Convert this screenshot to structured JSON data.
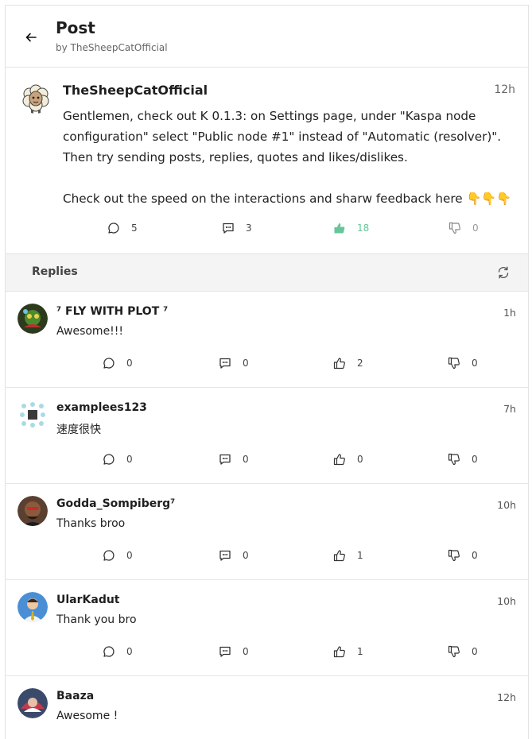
{
  "header": {
    "title": "Post",
    "subtitle": "by TheSheepCatOfficial"
  },
  "post": {
    "author": "TheSheepCatOfficial",
    "time": "12h",
    "body": "Gentlemen, check out K 0.1.3: on Settings page, under \"Kaspa node configuration\" select \"Public node #1\" instead of \"Automatic (resolver)\".\nThen try sending posts, replies, quotes and likes/dislikes.\n\nCheck out the speed on the interactions and sharw feedback here 👇👇👇",
    "replies": "5",
    "quotes": "3",
    "likes": "18",
    "dislikes": "0"
  },
  "replies_section": {
    "title": "Replies"
  },
  "replies": [
    {
      "author": "⁷ FLY WITH PLOT ⁷",
      "time": "1h",
      "text": "Awesome!!!",
      "replies": "0",
      "quotes": "0",
      "likes": "2",
      "dislikes": "0"
    },
    {
      "author": "examplees123",
      "time": "7h",
      "text": "速度很快",
      "replies": "0",
      "quotes": "0",
      "likes": "0",
      "dislikes": "0"
    },
    {
      "author": "Godda_Sompiberg⁷",
      "time": "10h",
      "text": "Thanks broo",
      "replies": "0",
      "quotes": "0",
      "likes": "1",
      "dislikes": "0"
    },
    {
      "author": "UlarKadut",
      "time": "10h",
      "text": "Thank you bro",
      "replies": "0",
      "quotes": "0",
      "likes": "1",
      "dislikes": "0"
    },
    {
      "author": "Baaza",
      "time": "12h",
      "text": "Awesome !",
      "replies": "",
      "quotes": "",
      "likes": "",
      "dislikes": ""
    }
  ],
  "colors": {
    "liked": "#66c59a",
    "divider": "#e4e4e4",
    "bar_bg": "#f4f4f4"
  },
  "icons": [
    "back-arrow-icon",
    "comment-icon",
    "quote-icon",
    "thumbs-up-icon",
    "thumbs-down-icon",
    "refresh-icon"
  ]
}
